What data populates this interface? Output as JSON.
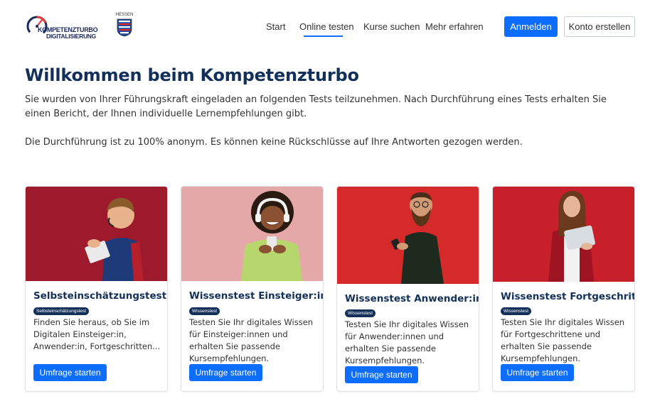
{
  "header": {
    "logo_line1": "KOMPETENZTURBO",
    "logo_line2": "DIGITALISIERUNG",
    "hessen_label": "HESSEN",
    "nav": [
      {
        "label": "Start",
        "active": false
      },
      {
        "label": "Online testen",
        "active": true
      },
      {
        "label": "Kurse suchen",
        "active": false
      },
      {
        "label": "Mehr erfahren",
        "active": false
      }
    ],
    "login_label": "Anmelden",
    "register_label": "Konto erstellen"
  },
  "intro": {
    "title": "Willkommen beim Kompetenzturbo",
    "paragraph1": "Sie wurden von Ihrer Führungskraft eingeladen an folgenden Tests teilzunehmen. Nach Durchführung eines Tests erhalten Sie einen Bericht, der Ihnen individuelle Lernempfehlungen gibt.",
    "paragraph2": "Die Durchführung ist zu 100% anonym. Es können keine Rückschlüsse auf Ihre Antworten gezogen werden."
  },
  "cards": [
    {
      "title": "Selbsteinschätzungstest",
      "badge": "Selbsteinschätzungstest",
      "text": "Finden Sie heraus, ob Sie im Digitalen Einsteiger:in, Anwender:in, Fortgeschritten...",
      "button": "Umfrage starten",
      "image_bg": "#a51c30",
      "image_icon": "boy-with-tablet-photo"
    },
    {
      "title": "Wissenstest Einsteiger:in",
      "badge": "Wissenstest",
      "text": "Testen Sie Ihr digitales Wissen für Einsteiger:innen und erhalten Sie passende Kursempfehlungen.",
      "button": "Umfrage starten",
      "image_bg": "#e4a8a8",
      "image_icon": "woman-with-headphones-photo"
    },
    {
      "title": "Wissenstest Anwender:in",
      "badge": "Wissenstest",
      "text": "Testen Sie Ihr digitales Wissen für Anwender:innen und erhalten Sie passende Kursempfehlungen.",
      "button": "Umfrage starten",
      "image_bg": "#d42a2a",
      "image_icon": "bearded-man-with-phone-photo"
    },
    {
      "title": "Wissenstest Fortgeschritten",
      "badge": "Wissenstest",
      "text": "Testen Sie Ihr digitales Wissen für Fortgeschrittene und erhalten Sie passende Kursempfehlungen.",
      "button": "Umfrage starten",
      "image_bg": "#c8202a",
      "image_icon": "woman-with-laptop-photo"
    }
  ],
  "colors": {
    "primary": "#0d6efd",
    "heading": "#12305a"
  }
}
